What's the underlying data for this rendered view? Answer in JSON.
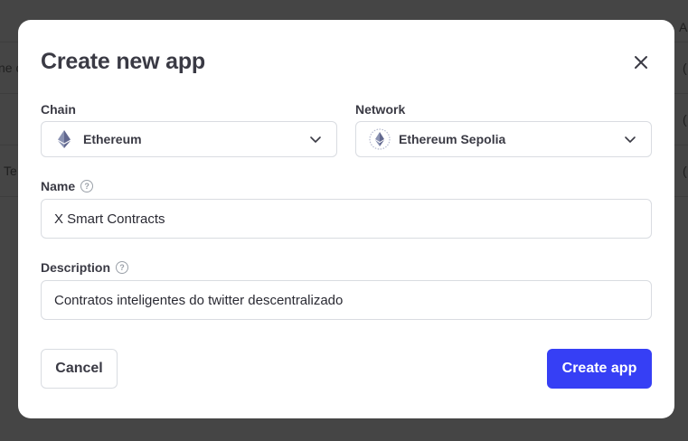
{
  "background": {
    "fragments": [
      "ne c",
      "Te",
      "A",
      "(",
      "(",
      "("
    ]
  },
  "modal": {
    "title": "Create new app",
    "close_icon": "close-icon",
    "chain": {
      "label": "Chain",
      "value": "Ethereum",
      "icon": "ethereum-icon"
    },
    "network": {
      "label": "Network",
      "value": "Ethereum Sepolia",
      "icon": "ethereum-sepolia-icon"
    },
    "name": {
      "label": "Name",
      "value": "X Smart Contracts"
    },
    "description": {
      "label": "Description",
      "value": "Contratos inteligentes do twitter descentralizado"
    },
    "help_glyph": "?",
    "cancel_label": "Cancel",
    "create_label": "Create app",
    "accent_color": "#363ff5"
  }
}
